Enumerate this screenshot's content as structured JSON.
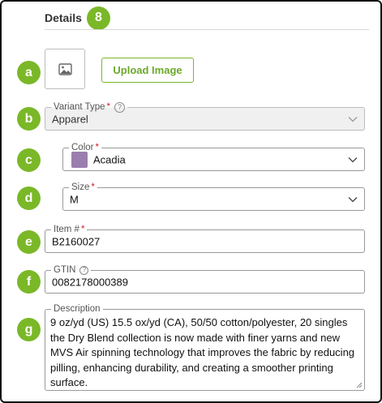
{
  "header": {
    "title": "Details",
    "step": "8"
  },
  "badges": {
    "a": "a",
    "b": "b",
    "c": "c",
    "d": "d",
    "e": "e",
    "f": "f",
    "g": "g"
  },
  "image": {
    "icon": "image-placeholder-icon",
    "upload_label": "Upload Image"
  },
  "variant_type": {
    "label": "Variant Type",
    "required": "*",
    "help": "?",
    "value": "Apparel"
  },
  "color": {
    "label": "Color",
    "required": "*",
    "value": "Acadia",
    "swatch": "#9a7fae"
  },
  "size": {
    "label": "Size",
    "required": "*",
    "value": "M"
  },
  "item_number": {
    "label": "Item #",
    "required": "*",
    "value": "B2160027"
  },
  "gtin": {
    "label": "GTIN",
    "help": "?",
    "value": "0082178000389"
  },
  "description": {
    "label": "Description",
    "value": "9 oz/yd (US) 15.5 ox/yd (CA), 50/50 cotton/polyester, 20 singles the Dry Blend collection is now made with finer yarns and new MVS Air spinning technology that improves the fabric by reducing pilling, enhancing durability, and creating a smoother printing surface."
  },
  "colors": {
    "accent": "#7ab828",
    "required": "#d0202a"
  }
}
